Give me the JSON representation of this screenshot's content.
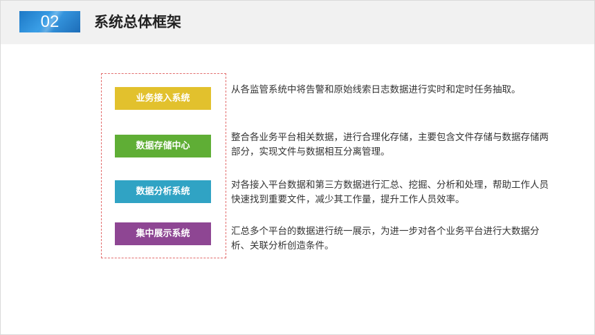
{
  "header": {
    "badge": "02",
    "title": "系统总体框架"
  },
  "modules": [
    {
      "label": "业务接入系统",
      "color": "#e2c12d",
      "desc": "从各监管系统中将告警和原始线索日志数据进行实时和定时任务抽取。"
    },
    {
      "label": "数据存储中心",
      "color": "#5fae35",
      "desc": "整合各业务平台相关数据，进行合理化存储，主要包含文件存储与数据存储两部分，实现文件与数据相互分离管理。"
    },
    {
      "label": "数据分析系统",
      "color": "#30a3c4",
      "desc": "对各接入平台数据和第三方数据进行汇总、挖掘、分析和处理，帮助工作人员快速找到重要文件，减少其工作量，提升工作人员效率。"
    },
    {
      "label": "集中展示系统",
      "color": "#8e4693",
      "desc": "汇总多个平台的数据进行统一展示，为进一步对各个业务平台进行大数据分析、关联分析创造条件。"
    }
  ]
}
